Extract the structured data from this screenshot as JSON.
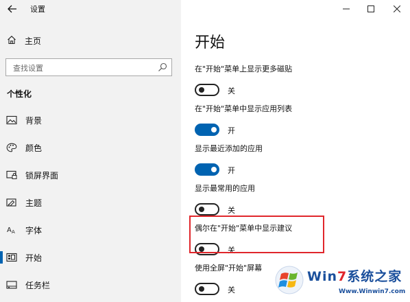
{
  "window": {
    "title": "设置",
    "back_icon": "arrow-left-icon",
    "controls": [
      "minimize",
      "maximize",
      "close"
    ]
  },
  "sidebar": {
    "home_label": "主页",
    "search_placeholder": "查找设置",
    "section_title": "个性化",
    "items": [
      {
        "label": "背景",
        "icon": "picture-icon",
        "active": false
      },
      {
        "label": "颜色",
        "icon": "palette-icon",
        "active": false
      },
      {
        "label": "锁屏界面",
        "icon": "lock-screen-icon",
        "active": false
      },
      {
        "label": "主题",
        "icon": "theme-icon",
        "active": false
      },
      {
        "label": "字体",
        "icon": "font-icon",
        "active": false
      },
      {
        "label": "开始",
        "icon": "start-icon",
        "active": true
      },
      {
        "label": "任务栏",
        "icon": "taskbar-icon",
        "active": false
      }
    ]
  },
  "main": {
    "title": "开始",
    "settings": [
      {
        "label": "在\"开始\"菜单上显示更多磁贴",
        "state": "关",
        "on": false
      },
      {
        "label": "在\"开始\"菜单中显示应用列表",
        "state": "开",
        "on": true
      },
      {
        "label": "显示最近添加的应用",
        "state": "开",
        "on": true
      },
      {
        "label": "显示最常用的应用",
        "state": "关",
        "on": false
      },
      {
        "label": "偶尔在\"开始\"菜单中显示建议",
        "state": "关",
        "on": false,
        "highlighted": true
      },
      {
        "label": "使用全屏\"开始\"屏幕",
        "state": "关",
        "on": false
      }
    ]
  },
  "watermark": {
    "brand_prefix": "Win",
    "brand_seven": "7",
    "brand_suffix": "系统之家",
    "url": "Www.Winwin7.com"
  },
  "colors": {
    "accent": "#0063b1",
    "highlight_border": "#e0262b",
    "sidebar_bg": "#f2f2f2"
  }
}
